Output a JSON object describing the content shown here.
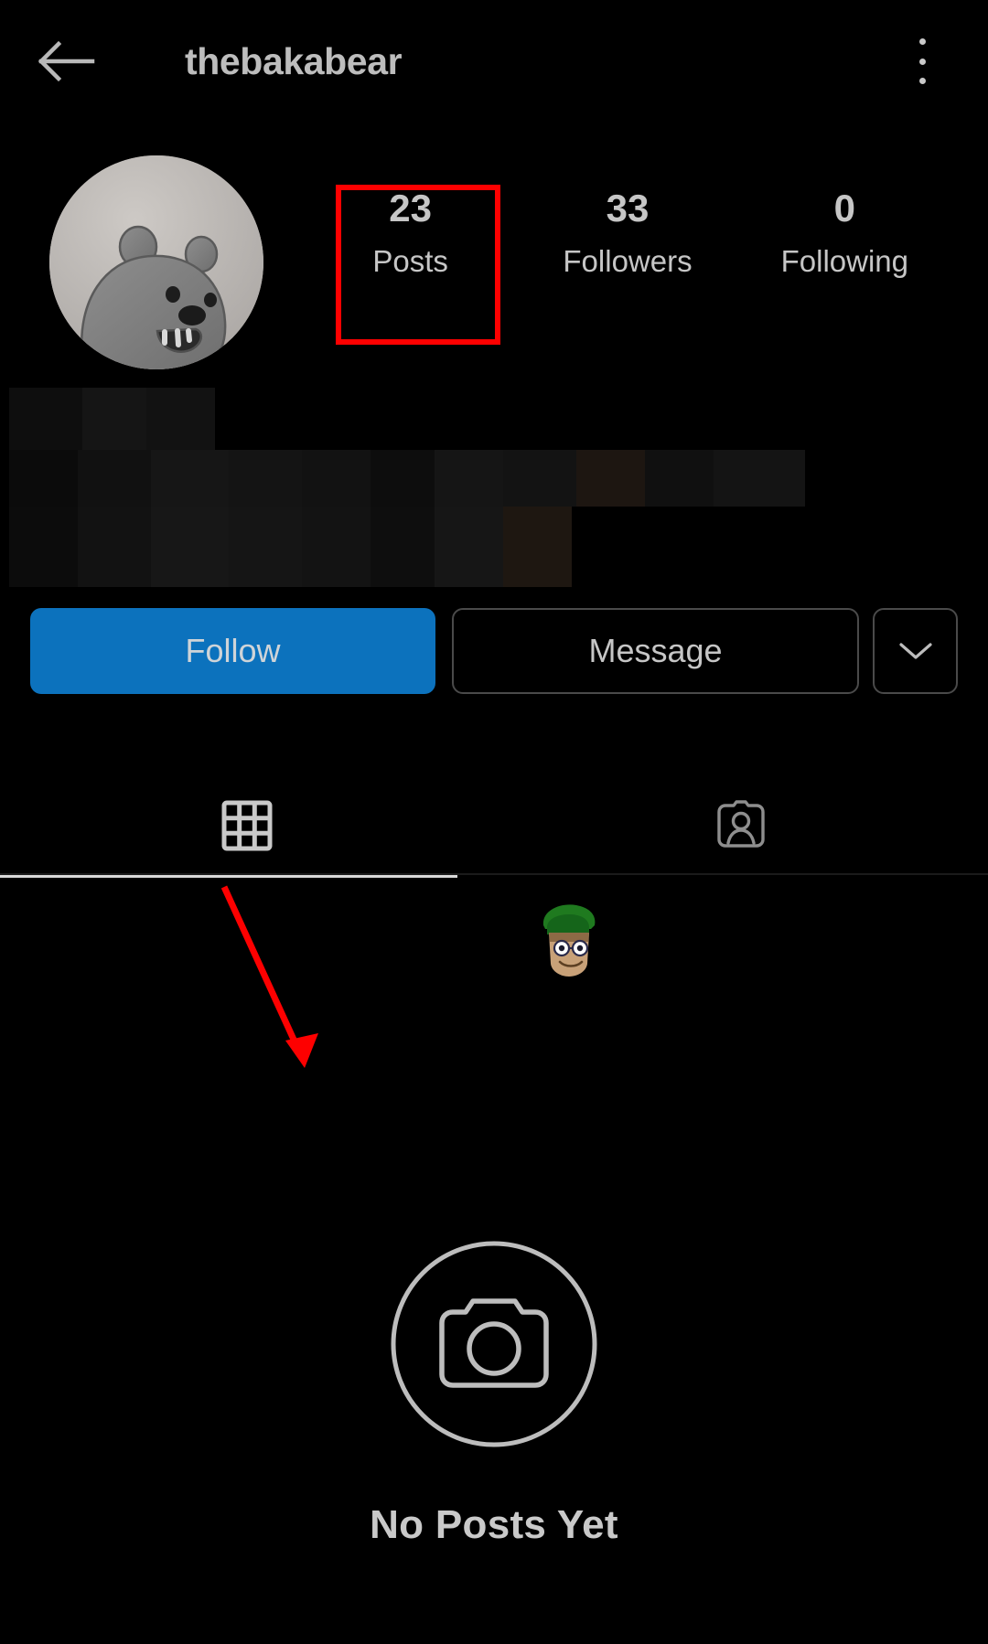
{
  "app": {
    "name": "instagram",
    "theme": "dark",
    "background": "#000000"
  },
  "header": {
    "title": "thebakabear",
    "back_icon": "arrow-left-icon",
    "menu_icon": "kebab-menu-icon"
  },
  "profile": {
    "avatar_icon": "bear-avatar",
    "avatar_description": "cartoon grizzly bear on light gray background",
    "bio_redacted": true
  },
  "stats": [
    {
      "value": "23",
      "label": "Posts",
      "highlighted": true
    },
    {
      "value": "33",
      "label": "Followers",
      "highlighted": false
    },
    {
      "value": "0",
      "label": "Following",
      "highlighted": false
    }
  ],
  "actions": {
    "follow_label": "Follow",
    "follow_color": "#0c72bd",
    "message_label": "Message",
    "more_icon": "chevron-down-icon"
  },
  "tabs": [
    {
      "name": "grid",
      "icon": "grid-icon",
      "active": true
    },
    {
      "name": "tagged",
      "icon": "tagged-person-icon",
      "active": false
    }
  ],
  "empty_state": {
    "icon": "camera-circle-icon",
    "text": "No Posts Yet"
  },
  "annotations": {
    "box_color": "#fe0000",
    "arrow_color": "#fe0000",
    "box_target": "Posts",
    "arrow_target": "empty-feed-area"
  }
}
